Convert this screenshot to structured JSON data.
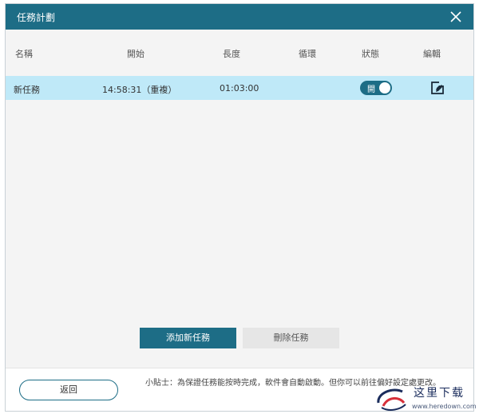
{
  "window": {
    "title": "任務計劃"
  },
  "table": {
    "headers": [
      "名稱",
      "開始",
      "長度",
      "循環",
      "狀態",
      "編輯"
    ],
    "rows": [
      {
        "name": "新任務",
        "start": "14:58:31（重複）",
        "length": "01:03:00",
        "cycle": "",
        "status": "開",
        "status_on": true
      }
    ]
  },
  "buttons": {
    "add": "添加新任務",
    "delete": "刪除任務",
    "back": "返回"
  },
  "footer": {
    "tip": "小貼士：為保證任務能按時完成，軟件會自動啟動。但你可以前往偏好設定處更改。"
  },
  "watermark": {
    "text": "这里下载",
    "url": "www.heredown.com"
  },
  "colors": {
    "accent": "#1d6d86",
    "row_highlight": "#bfe9f8"
  },
  "icons": {
    "close": "close-icon",
    "edit": "edit-icon"
  }
}
